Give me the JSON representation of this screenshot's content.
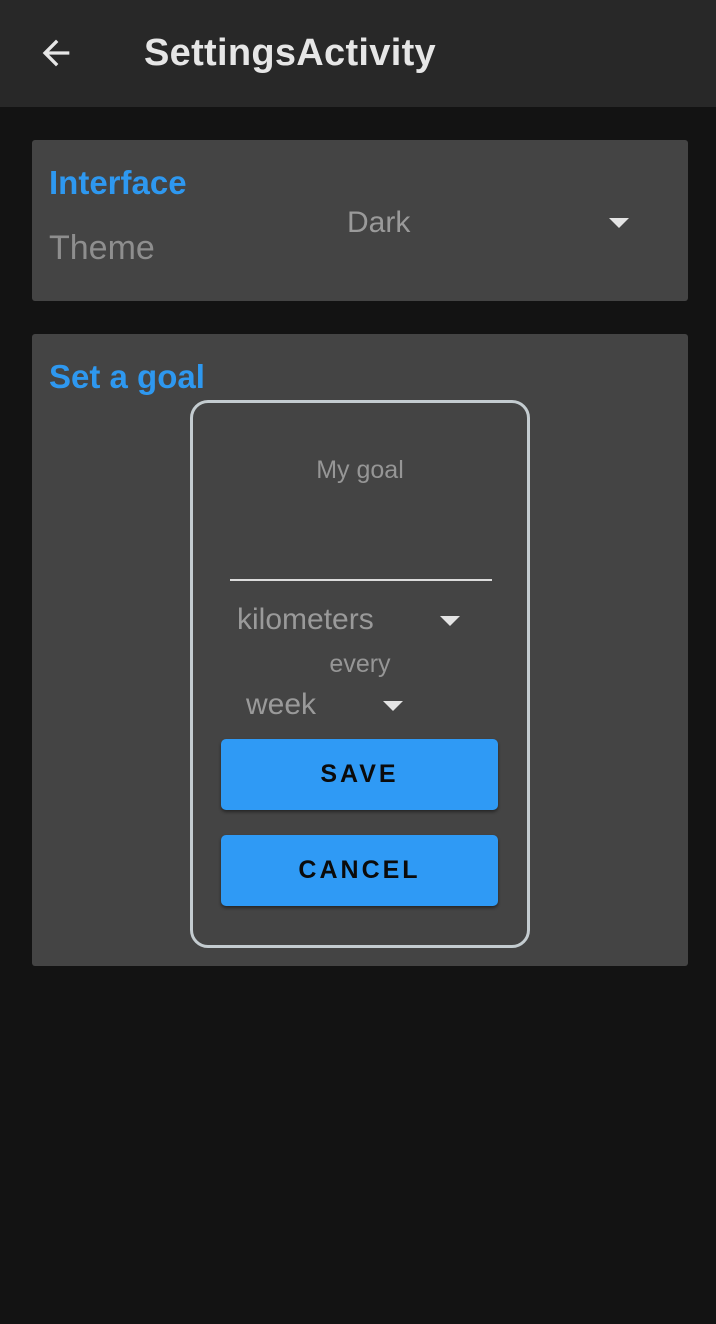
{
  "appbar": {
    "title": "SettingsActivity",
    "back_icon": "arrow-back-icon"
  },
  "interface": {
    "section_title": "Interface",
    "theme_label": "Theme",
    "theme_value": "Dark",
    "dropdown_icon": "caret-down-icon"
  },
  "goal": {
    "section_title": "Set a goal",
    "dialog": {
      "input_hint": "My goal",
      "input_value": "",
      "unit_value": "kilometers",
      "every_label": "every",
      "period_value": "week",
      "save_label": "SAVE",
      "cancel_label": "CANCEL"
    }
  },
  "colors": {
    "background": "#131313",
    "appbar": "#282828",
    "card": "#444444",
    "accent": "#2e98f0",
    "button": "#2f9af5",
    "dialog_border": "#c4ccd0"
  }
}
